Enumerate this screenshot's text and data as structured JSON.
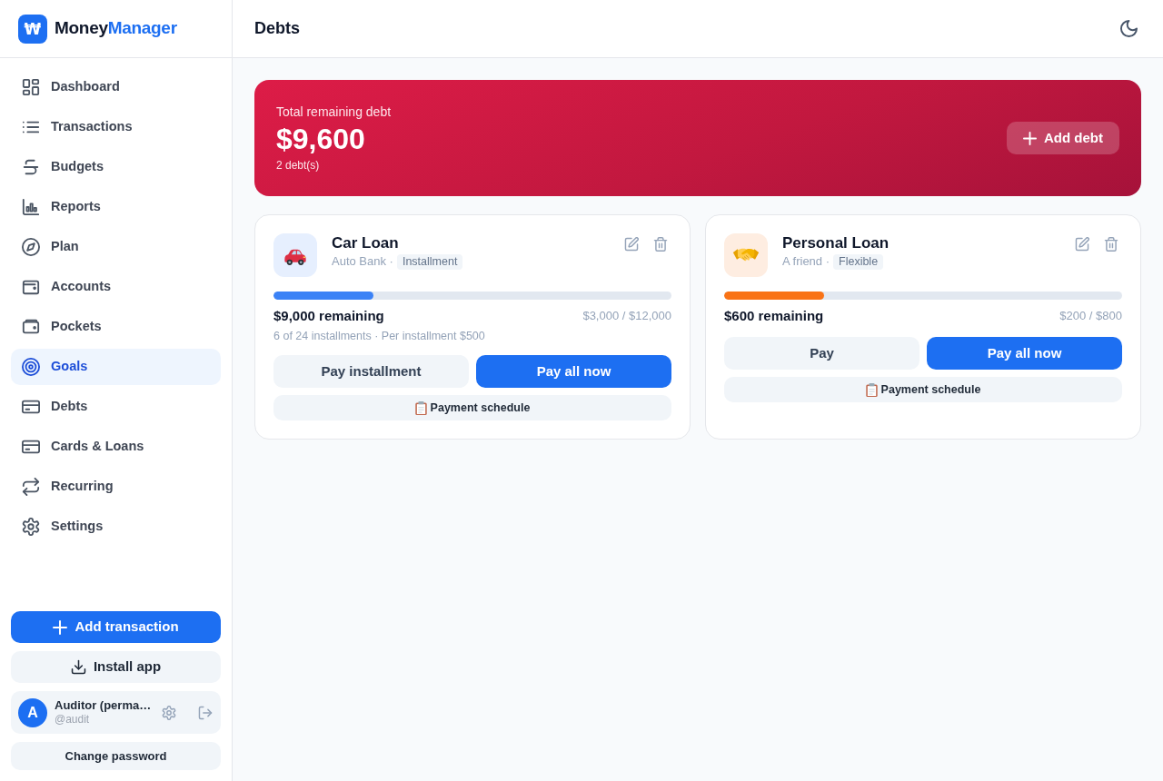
{
  "brand": {
    "mark": "₩",
    "name_primary": "Money",
    "name_accent": "Manager"
  },
  "sidebar": {
    "items": [
      {
        "label": "Dashboard",
        "selected": false
      },
      {
        "label": "Transactions",
        "selected": false
      },
      {
        "label": "Budgets",
        "selected": false
      },
      {
        "label": "Reports",
        "selected": false
      },
      {
        "label": "Plan",
        "selected": false
      },
      {
        "label": "Accounts",
        "selected": false
      },
      {
        "label": "Pockets",
        "selected": false
      },
      {
        "label": "Goals",
        "selected": true
      },
      {
        "label": "Debts",
        "selected": false
      },
      {
        "label": "Cards & Loans",
        "selected": false
      },
      {
        "label": "Recurring",
        "selected": false
      },
      {
        "label": "Settings",
        "selected": false
      }
    ],
    "add_button": "Add transaction",
    "install_button": "Install app",
    "user": {
      "avatar": "A",
      "name": "Auditor (perma…",
      "handle": "@audit"
    },
    "change_password_button": "Change password"
  },
  "header": {
    "title": "Debts"
  },
  "summary": {
    "label": "Total remaining debt",
    "amount": "$9,600",
    "count": "2 debt(s)",
    "add_button": "Add debt"
  },
  "debts": [
    {
      "name": "Car Loan",
      "lender": "Auto Bank ·",
      "tag": "Installment",
      "color": "#3b82f6",
      "level": 0.25,
      "remaining": "$9,000 remaining",
      "progress_text": "$3,000 / $12,000",
      "details": "6 of 24 installments · Per installment $500",
      "pay_button": "Pay installment",
      "pay_all_button": "Pay all now",
      "schedule_button": "Payment schedule"
    },
    {
      "name": "Personal Loan",
      "lender": "A friend ·",
      "tag": "Flexible",
      "color": "#f97316",
      "level": 0.25,
      "remaining": "$600 remaining",
      "progress_text": "$200 / $800",
      "pay_button": "Pay",
      "pay_all_button": "Pay all now",
      "schedule_button": "Payment schedule"
    }
  ]
}
